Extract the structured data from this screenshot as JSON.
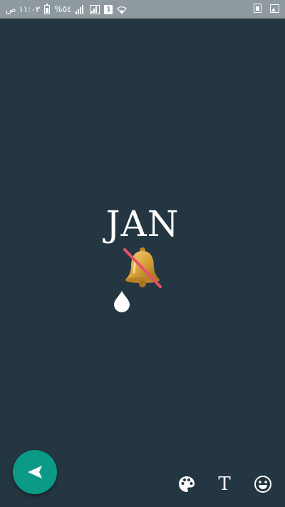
{
  "status_bar": {
    "time": "١١:٠٣ ص",
    "battery_level": "%٥٤",
    "sim_indicator": "1"
  },
  "editor": {
    "text": "JAN",
    "emoji": "muted-bell",
    "cursor": "text-cursor-drop-icon"
  },
  "toolbar": {
    "send": "send-icon",
    "palette": "palette-icon",
    "text_tool_label": "T",
    "emoji": "smiley-icon"
  },
  "colors": {
    "background": "#243641",
    "status_bar": "#8e9a9f",
    "fab": "#0a9a86",
    "foreground": "#ffffff"
  }
}
